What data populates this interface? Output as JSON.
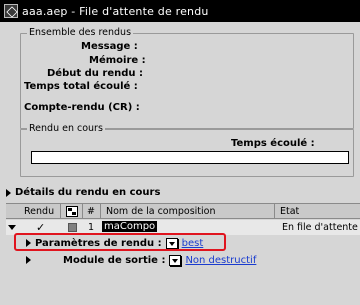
{
  "window": {
    "title": "aaa.aep - File d'attente de rendu"
  },
  "summary": {
    "legend": "Ensemble des rendus",
    "rows": [
      {
        "label": "Message :"
      },
      {
        "label": "Mémoire :"
      },
      {
        "label": "Début du rendu :"
      },
      {
        "label": "Temps total écoulé :"
      },
      {
        "label": "Compte-rendu (CR) :"
      }
    ]
  },
  "current": {
    "legend": "Rendu en cours",
    "elapsed_label": "Temps écoulé :"
  },
  "details": {
    "label": "Détails du rendu en cours"
  },
  "table": {
    "headers": {
      "render": "Rendu",
      "number": "#",
      "comp_name": "Nom de la composition",
      "status": "Etat"
    },
    "rows": [
      {
        "number": "1",
        "comp_name": "maCompo",
        "status": "En file d'attente",
        "checked": true
      }
    ]
  },
  "render_settings": {
    "label": "Paramètres de rendu :",
    "value": "best"
  },
  "output_module": {
    "label": "Module de sortie :",
    "value": "Non destructif"
  },
  "colors": {
    "highlight": "#e0141e",
    "link": "#1a3ccf"
  }
}
